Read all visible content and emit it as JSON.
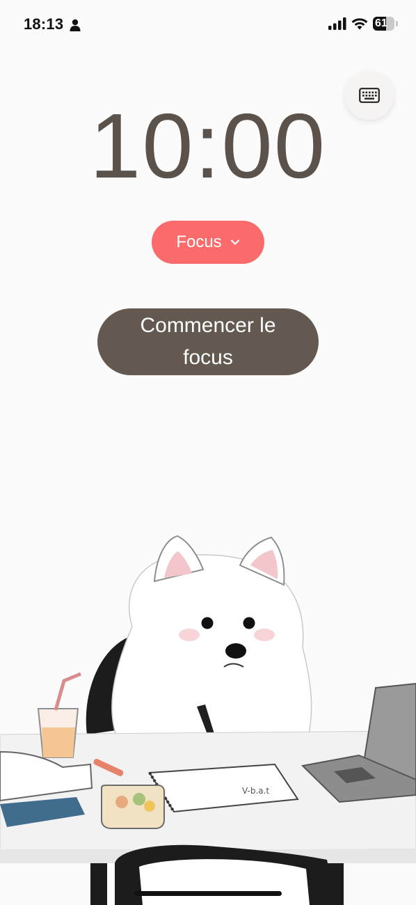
{
  "status_bar": {
    "time": "18:13",
    "battery_level": "61",
    "battery_fraction": 0.61
  },
  "timer": {
    "display": "10:00"
  },
  "mode_dropdown": {
    "label": "Focus"
  },
  "start_button": {
    "label": "Commencer le focus"
  },
  "illustration": {
    "notebook_scribble": "V-b.a.t"
  },
  "colors": {
    "timer_text": "#5b524b",
    "mode_accent": "#fb6b6c",
    "start_button_bg": "#645951",
    "background": "#fcfbfb"
  },
  "icons": {
    "keyboard": "keyboard-icon",
    "dropdown": "chevron-down-icon",
    "person": "person-icon",
    "signal": "signal-icon",
    "wifi": "wifi-icon"
  }
}
